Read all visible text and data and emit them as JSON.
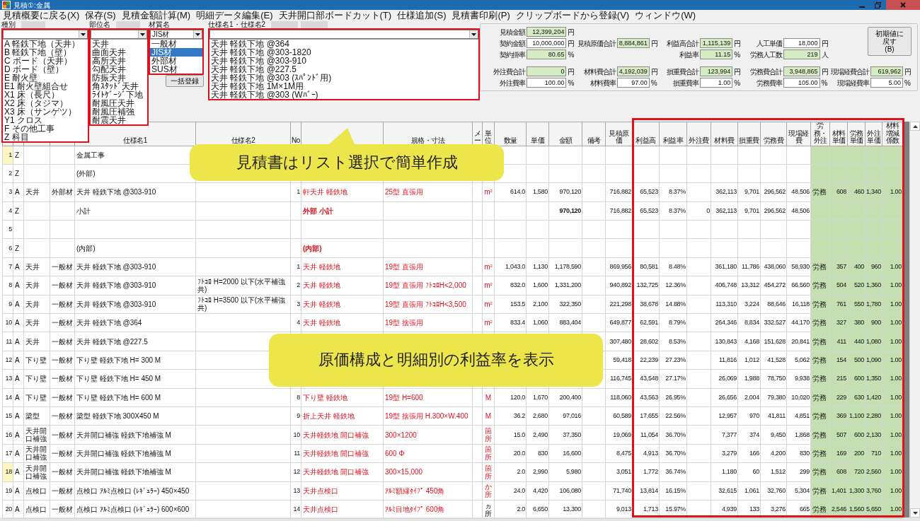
{
  "window": {
    "title": "見積①:金属"
  },
  "menu": [
    "見積概要に戻る(X)",
    "保存(S)",
    "見積金額計算(M)",
    "明細データ編集(E)",
    "天井開口部ボードカット(T)",
    "仕様追加(S)",
    "見積書印刷(P)",
    "クリップボードから登録(V)",
    "ウィンドウ(W)"
  ],
  "selectors": [
    {
      "label": "種別",
      "items": [
        {
          "text": "A 軽鉄下地（天井）",
          "selected": false
        },
        {
          "text": "B 軽鉄下地（壁）",
          "selected": false
        },
        {
          "text": "C ボード（天井）",
          "selected": false
        },
        {
          "text": "D ボード（壁）",
          "selected": false
        },
        {
          "text": "E 耐火壁",
          "selected": false
        },
        {
          "text": "E1 耐火壁組合せ",
          "selected": false
        },
        {
          "text": "X1 床（長尺）",
          "selected": false
        },
        {
          "text": "X2 床（タジマ）",
          "selected": false
        },
        {
          "text": "X3 床（サンゲツ）",
          "selected": false
        },
        {
          "text": "Y1 クロス",
          "selected": false
        },
        {
          "text": "F その他工事",
          "selected": false
        },
        {
          "text": "Z 科目",
          "selected": false
        }
      ]
    },
    {
      "label": "部位名",
      "items": [
        {
          "text": "天井",
          "selected": false
        },
        {
          "text": "曲面天井",
          "selected": false
        },
        {
          "text": "高所天井",
          "selected": false
        },
        {
          "text": "勾配天井",
          "selected": false
        },
        {
          "text": "防振天井",
          "selected": false
        },
        {
          "text": "角ｽﾀｯﾄﾞ天井",
          "selected": false
        },
        {
          "text": "ﾗｲﾄｹﾞｰｼﾞ下地",
          "selected": false
        },
        {
          "text": "耐風圧天井",
          "selected": false
        },
        {
          "text": "耐風圧補強",
          "selected": false
        },
        {
          "text": "耐震天井",
          "selected": false
        }
      ]
    },
    {
      "label": "材質名",
      "value": "JIS材",
      "items": [
        {
          "text": "一般材",
          "selected": false
        },
        {
          "text": "JIS材",
          "selected": true
        },
        {
          "text": "外部材",
          "selected": false
        },
        {
          "text": "SUS材",
          "selected": false
        }
      ]
    },
    {
      "label": "仕様名1・仕様名2",
      "items": [
        {
          "text": "天井 軽鉄下地 @364",
          "selected": false
        },
        {
          "text": "天井 軽鉄下地 @303-1820",
          "selected": false
        },
        {
          "text": "天井 軽鉄下地 @303-910",
          "selected": false
        },
        {
          "text": "天井 軽鉄下地 @227.5",
          "selected": false
        },
        {
          "text": "天井 軽鉄下地 @303 (ｽﾊﾟﾝﾄﾞ用)",
          "selected": false
        },
        {
          "text": "天井 軽鉄下地 1M×1M用",
          "selected": false
        },
        {
          "text": "天井 軽鉄下地 @303 (Wﾊﾞｰ)",
          "selected": false
        }
      ]
    }
  ],
  "register_button": "一括登録",
  "summary": {
    "rows": [
      [
        {
          "label": "見積金額",
          "value": "12,399,204",
          "unit": "円",
          "kind": "computed"
        },
        null,
        null,
        null,
        null
      ],
      [
        {
          "label": "契約金額",
          "value": "10,000,000",
          "unit": "円",
          "kind": "input"
        },
        {
          "label": "見積原価合計",
          "value": "8,884,861",
          "unit": "円",
          "kind": "computed"
        },
        {
          "label": "利益高合計",
          "value": "1,115,139",
          "unit": "円",
          "kind": "computed"
        },
        {
          "label": "人工単価",
          "value": "18,000",
          "unit": "円",
          "kind": "input"
        },
        null
      ],
      [
        {
          "label": "契約掛率",
          "value": "80.65",
          "unit": "%",
          "kind": "computed"
        },
        null,
        {
          "label": "利益率",
          "value": "11.15",
          "unit": "%",
          "kind": "computed"
        },
        {
          "label": "労務人工数",
          "value": "219",
          "unit": "人",
          "kind": "computed"
        },
        null
      ],
      [
        {
          "label": "外注費合計",
          "value": "0",
          "unit": "円",
          "kind": "computed"
        },
        {
          "label": "材料費合計",
          "value": "4,192,039",
          "unit": "円",
          "kind": "computed"
        },
        {
          "label": "損重費合計",
          "value": "123,994",
          "unit": "円",
          "kind": "computed"
        },
        {
          "label": "労務費合計",
          "value": "3,948,865",
          "unit": "円",
          "kind": "computed"
        },
        {
          "label": "現場経費合計",
          "value": "619,962",
          "unit": "円",
          "kind": "computed"
        }
      ],
      [
        {
          "label": "外注費率",
          "value": "100.00",
          "unit": "%",
          "kind": "input"
        },
        {
          "label": "材料費率",
          "value": "97.00",
          "unit": "%",
          "kind": "input"
        },
        {
          "label": "損重費率",
          "value": "1.00",
          "unit": "%",
          "kind": "input"
        },
        {
          "label": "労務費率",
          "value": "105.00",
          "unit": "%",
          "kind": "input"
        },
        {
          "label": "現場経費率",
          "value": "5.00",
          "unit": "%",
          "kind": "input"
        }
      ]
    ],
    "reset_button": [
      "初期値に戻す",
      "(B)"
    ]
  },
  "table": {
    "headers": {
      "spec_name_1": "仕様名1",
      "spec_name_2": "仕様名2",
      "no": "No",
      "size": "規格・寸法",
      "maker": "メー",
      "unit": "単位",
      "quantity": "数量",
      "unit_price": "単価",
      "amount": "金額",
      "remarks": "備考",
      "estimated_cost": "見積原価",
      "profit": "利益高",
      "profit_rate": "利益率",
      "outsourcing": "外注費",
      "material_cost": "材料費",
      "loss_cost": "損重費",
      "labor_cost": "労務費",
      "site_cost": "現場経費",
      "labor_or_outsource": "労務・外注",
      "material_unit_price": "材料単価",
      "labor_unit_price": "労務単価",
      "outsource_unit_price": "外注単価",
      "material_coefficient": "材料増減係数"
    },
    "rows": [
      {
        "row_number": "1",
        "column_2": "Z",
        "spec_name_1": "金属工事",
        "kind": "heading",
        "marked": true
      },
      {
        "row_number": "2",
        "column_2": "Z",
        "spec_name_1": "(外部)",
        "kind": "heading",
        "marked": false
      },
      {
        "row_number": "3",
        "column_2": "A",
        "column_3": "天井",
        "column_4": "外部材",
        "spec_name_1": "天井 軽鉄下地 @303-910",
        "no": "1",
        "column_8": "軒天井 軽鉄地",
        "size": "25型 直張用",
        "unit": "m$^{2}$",
        "quantity": "614.0",
        "unit_price": "1,580",
        "amount": "970,120",
        "estimated_cost": "716,882",
        "profit": "65,523",
        "profit_rate": "8.37%",
        "material_cost": "362,113",
        "loss_cost": "9,701",
        "labor_cost": "296,562",
        "site_cost": "48,506",
        "labor_or_outsource": "労務",
        "material_unit_price": "608",
        "labor_unit_price": "460",
        "outsource_unit_price": "1,340",
        "material_coefficient": "1.00",
        "kind": "item",
        "marked": false,
        "unit_red": true
      },
      {
        "row_number": "4",
        "column_2": "Z",
        "spec_name_1": "小計",
        "column_8": "外部 小計",
        "amount": "970,120",
        "estimated_cost": "716,882",
        "profit": "65,523",
        "profit_rate": "8.37%",
        "outsourcing": "0",
        "material_cost": "362,113",
        "loss_cost": "9,701",
        "labor_cost": "296,562",
        "site_cost": "48,506",
        "kind": "subtotal",
        "marked": false
      },
      {
        "row_number": "5",
        "kind": "blank",
        "marked": false
      },
      {
        "row_number": "6",
        "column_2": "Z",
        "spec_name_1": "(内部)",
        "column_8": "(内部)",
        "kind": "heading",
        "marked": false
      },
      {
        "row_number": "7",
        "column_2": "A",
        "column_3": "天井",
        "column_4": "一般材",
        "spec_name_1": "天井 軽鉄下地 @303-910",
        "no": "1",
        "column_8": "天井 軽鉄地",
        "size": "19型 直張用",
        "unit": "m$^{2}$",
        "quantity": "1,043.0",
        "unit_price": "1,130",
        "amount": "1,178,590",
        "estimated_cost": "869,956",
        "profit": "80,581",
        "profit_rate": "8.48%",
        "material_cost": "361,180",
        "loss_cost": "11,786",
        "labor_cost": "438,060",
        "site_cost": "58,930",
        "labor_or_outsource": "労務",
        "material_unit_price": "357",
        "labor_unit_price": "400",
        "outsource_unit_price": "960",
        "material_coefficient": "1.00",
        "kind": "item",
        "marked": false,
        "unit_red": true
      },
      {
        "row_number": "8",
        "column_2": "A",
        "column_3": "天井",
        "column_4": "一般材",
        "spec_name_1": "天井 軽鉄下地 @303-910",
        "spec_name_2": "ﾌﾄｺﾛ H=2000 以下(水平補強共)",
        "no": "2",
        "column_8": "天井 軽鉄地",
        "size": "19型 直張用 ﾌﾄｺﾛH<2,000",
        "unit": "m$^{2}$",
        "quantity": "832.0",
        "unit_price": "1,600",
        "amount": "1,331,200",
        "estimated_cost": "940,892",
        "profit": "132,725",
        "profit_rate": "12.36%",
        "material_cost": "406,748",
        "loss_cost": "13,312",
        "labor_cost": "454,272",
        "site_cost": "66,560",
        "labor_or_outsource": "労務",
        "material_unit_price": "504",
        "labor_unit_price": "520",
        "outsource_unit_price": "1,360",
        "material_coefficient": "1.00",
        "kind": "item",
        "marked": false,
        "unit_red": true
      },
      {
        "row_number": "9",
        "column_2": "A",
        "column_3": "天井",
        "column_4": "一般材",
        "spec_name_1": "天井 軽鉄下地 @303-910",
        "spec_name_2": "ﾌﾄｺﾛ H=3500 以下(水平補強共)",
        "no": "3",
        "column_8": "天井 軽鉄地",
        "size": "19型 直張用 ﾌﾄｺﾛH<3,500",
        "unit": "m$^{2}$",
        "quantity": "153.5",
        "unit_price": "2,100",
        "amount": "322,350",
        "estimated_cost": "221,298",
        "profit": "38,678",
        "profit_rate": "14.88%",
        "material_cost": "113,310",
        "loss_cost": "3,224",
        "labor_cost": "88,646",
        "site_cost": "16,118",
        "labor_or_outsource": "労務",
        "material_unit_price": "761",
        "labor_unit_price": "550",
        "outsource_unit_price": "1,780",
        "material_coefficient": "1.00",
        "kind": "item",
        "marked": false,
        "unit_red": true
      },
      {
        "row_number": "10",
        "column_2": "A",
        "column_3": "天井",
        "column_4": "一般材",
        "spec_name_1": "天井 軽鉄下地 @364",
        "no": "4",
        "column_8": "天井 軽鉄地",
        "size": "19型 捨張用",
        "unit": "m$^{2}$",
        "quantity": "833.4",
        "unit_price": "1,060",
        "amount": "883,404",
        "estimated_cost": "649,877",
        "profit": "62,591",
        "profit_rate": "8.79%",
        "material_cost": "264,346",
        "loss_cost": "8,834",
        "labor_cost": "332,527",
        "site_cost": "44,170",
        "labor_or_outsource": "労務",
        "material_unit_price": "327",
        "labor_unit_price": "380",
        "outsource_unit_price": "900",
        "material_coefficient": "1.00",
        "kind": "item",
        "marked": false,
        "unit_red": true
      },
      {
        "row_number": "11",
        "column_2": "A",
        "column_3": "天井",
        "column_4": "一般材",
        "spec_name_1": "天井 軽鉄下地 @227.5",
        "estimated_cost": "307,480",
        "profit": "28,602",
        "profit_rate": "8.53%",
        "material_cost": "130,843",
        "loss_cost": "4,168",
        "labor_cost": "151,628",
        "site_cost": "20,841",
        "labor_or_outsource": "労務",
        "material_unit_price": "411",
        "labor_unit_price": "440",
        "outsource_unit_price": "1,080",
        "material_coefficient": "1.00",
        "kind": "item",
        "marked": false
      },
      {
        "row_number": "12",
        "column_2": "A",
        "column_3": "下り壁",
        "column_4": "一般材",
        "spec_name_1": "下り壁 軽鉄下地 H= 300 M",
        "estimated_cost": "59,418",
        "profit": "22,239",
        "profit_rate": "27.23%",
        "material_cost": "11,816",
        "loss_cost": "1,012",
        "labor_cost": "41,528",
        "site_cost": "5,062",
        "labor_or_outsource": "労務",
        "material_unit_price": "154",
        "labor_unit_price": "500",
        "outsource_unit_price": "1,090",
        "material_coefficient": "1.00",
        "kind": "item",
        "marked": false
      },
      {
        "row_number": "13",
        "column_2": "A",
        "column_3": "下り壁",
        "column_4": "一般材",
        "spec_name_1": "下り壁 軽鉄下地 H= 450 M",
        "estimated_cost": "116,745",
        "profit": "43,548",
        "profit_rate": "27.17%",
        "material_cost": "26,069",
        "loss_cost": "1,988",
        "labor_cost": "78,750",
        "site_cost": "9,938",
        "labor_or_outsource": "労務",
        "material_unit_price": "215",
        "labor_unit_price": "600",
        "outsource_unit_price": "1,350",
        "material_coefficient": "1.00",
        "kind": "item",
        "marked": false
      },
      {
        "row_number": "14",
        "column_2": "A",
        "column_3": "下り壁",
        "column_4": "一般材",
        "spec_name_1": "下り壁 軽鉄下地 H= 600 M",
        "no": "8",
        "column_8": "下り壁 軽鉄地",
        "size": "19型 H=600",
        "unit": "M",
        "quantity": "120.0",
        "unit_price": "1,670",
        "amount": "200,400",
        "estimated_cost": "118,060",
        "profit": "43,563",
        "profit_rate": "26.95%",
        "material_cost": "26,656",
        "loss_cost": "2,004",
        "labor_cost": "79,380",
        "site_cost": "10,020",
        "labor_or_outsource": "労務",
        "material_unit_price": "229",
        "labor_unit_price": "630",
        "outsource_unit_price": "1,420",
        "material_coefficient": "1.00",
        "kind": "item",
        "marked": false,
        "unit_red": true
      },
      {
        "row_number": "15",
        "column_2": "A",
        "column_3": "梁型",
        "column_4": "一般材",
        "spec_name_1": "梁型 軽鉄下地 300X450 M",
        "no": "9",
        "column_8": "折上天井 軽鉄地",
        "size": "19型 捨張用 H.300×W.400",
        "unit": "M",
        "quantity": "36.2",
        "unit_price": "2,680",
        "amount": "97,016",
        "estimated_cost": "60,589",
        "profit": "17,655",
        "profit_rate": "22.56%",
        "material_cost": "12,957",
        "loss_cost": "970",
        "labor_cost": "41,811",
        "site_cost": "4,851",
        "labor_or_outsource": "労務",
        "material_unit_price": "369",
        "labor_unit_price": "1,100",
        "outsource_unit_price": "2,280",
        "material_coefficient": "1.00",
        "kind": "item",
        "marked": false,
        "unit_red": true
      },
      {
        "row_number": "16",
        "column_2": "A",
        "column_3": "天井開口補強",
        "column_4": "一般材",
        "spec_name_1": "天井開口補強 軽鉄下地補強 M",
        "no": "10",
        "column_8": "天井軽鉄地 開口補強",
        "size": "300×1200",
        "unit": "箇所",
        "quantity": "15.0",
        "unit_price": "2,490",
        "amount": "37,350",
        "estimated_cost": "19,069",
        "profit": "11,054",
        "profit_rate": "36.70%",
        "material_cost": "7,377",
        "loss_cost": "374",
        "labor_cost": "9,450",
        "site_cost": "1,868",
        "labor_or_outsource": "労務",
        "material_unit_price": "507",
        "labor_unit_price": "600",
        "outsource_unit_price": "2,130",
        "material_coefficient": "1.00",
        "kind": "item",
        "marked": false,
        "unit_red": true
      },
      {
        "row_number": "17",
        "column_2": "A",
        "column_3": "天井開口補強",
        "column_4": "一般材",
        "spec_name_1": "天井開口補強 軽鉄下地補強 M",
        "no": "11",
        "column_8": "天井軽鉄地 開口補強",
        "size": "600 Φ",
        "unit": "箇所",
        "quantity": "20.0",
        "unit_price": "830",
        "amount": "16,600",
        "estimated_cost": "8,475",
        "profit": "4,913",
        "profit_rate": "36.70%",
        "material_cost": "3,279",
        "loss_cost": "166",
        "labor_cost": "4,200",
        "site_cost": "830",
        "labor_or_outsource": "労務",
        "material_unit_price": "169",
        "labor_unit_price": "200",
        "outsource_unit_price": "710",
        "material_coefficient": "1.00",
        "kind": "item",
        "marked": false,
        "unit_red": true
      },
      {
        "row_number": "18",
        "column_2": "A",
        "column_3": "天井開口補強",
        "column_4": "一般材",
        "spec_name_1": "天井開口補強 軽鉄下地補強 M",
        "no": "12",
        "column_8": "天井軽鉄地 開口補強",
        "size": "300×15,000",
        "unit": "箇所",
        "quantity": "2.0",
        "unit_price": "2,990",
        "amount": "5,980",
        "estimated_cost": "3,051",
        "profit": "1,772",
        "profit_rate": "36.74%",
        "material_cost": "1,180",
        "loss_cost": "60",
        "labor_cost": "1,512",
        "site_cost": "299",
        "labor_or_outsource": "労務",
        "material_unit_price": "608",
        "labor_unit_price": "720",
        "outsource_unit_price": "2,560",
        "material_coefficient": "1.00",
        "kind": "item",
        "marked": true,
        "unit_red": true
      },
      {
        "row_number": "19",
        "column_2": "A",
        "column_3": "点検口",
        "column_4": "一般材",
        "spec_name_1": "点検口 ｱﾙﾐ点検口 (ﾚｷﾞｭﾗｰ) 450×450",
        "no": "13",
        "column_8": "天井点検口",
        "size": "ｱﾙﾐ額縁ﾀｲﾌﾟ 450角",
        "unit": "か所",
        "quantity": "24.0",
        "unit_price": "4,420",
        "amount": "106,080",
        "estimated_cost": "71,740",
        "profit": "13,814",
        "profit_rate": "16.15%",
        "material_cost": "32,615",
        "loss_cost": "1,061",
        "labor_cost": "32,760",
        "site_cost": "5,304",
        "labor_or_outsource": "労務",
        "material_unit_price": "1,401",
        "labor_unit_price": "1,300",
        "outsource_unit_price": "3,760",
        "material_coefficient": "1.00",
        "kind": "item",
        "marked": false,
        "unit_red": true
      },
      {
        "row_number": "20",
        "column_2": "A",
        "column_3": "点検口",
        "column_4": "一般材",
        "spec_name_1": "点検口 ｱﾙﾐ点検口 (ﾚｷﾞｭﾗｰ) 600×600",
        "no": "14",
        "column_8": "天井点検口",
        "size": "ｱﾙﾐ目地ﾀｲﾌﾟ 600角",
        "unit": "ヵ所",
        "quantity": "2.0",
        "unit_price": "6,650",
        "amount": "13,300",
        "estimated_cost": "9,013",
        "profit": "1,713",
        "profit_rate": "15.97%",
        "material_cost": "4,939",
        "loss_cost": "133",
        "labor_cost": "3,276",
        "site_cost": "665",
        "labor_or_outsource": "労務",
        "material_unit_price": "2,546",
        "labor_unit_price": "1,560",
        "outsource_unit_price": "5,650",
        "material_coefficient": "1.00",
        "kind": "item",
        "marked": false,
        "unit_red": false
      }
    ]
  },
  "callouts": [
    "見積書はリスト選択で簡単作成",
    "原価構成と明細別の利益率を表示"
  ]
}
